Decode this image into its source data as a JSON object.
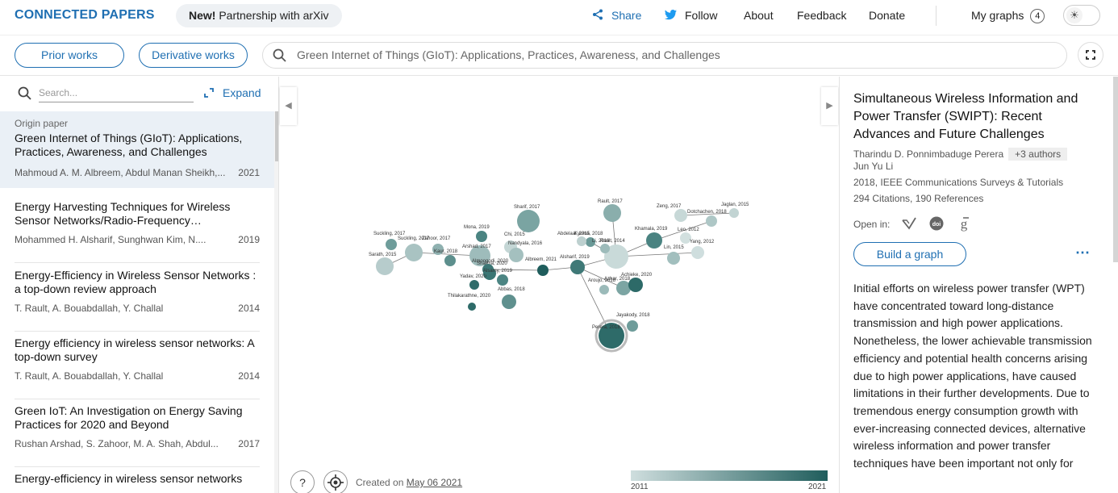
{
  "topbar": {
    "brand": "CONNECTED PAPERS",
    "promo_bold": "New!",
    "promo_text": " Partnership with arXiv",
    "nav": {
      "share": "Share",
      "follow": "Follow",
      "about": "About",
      "feedback": "Feedback",
      "donate": "Donate"
    },
    "my_graphs": "My graphs",
    "my_graphs_count": "4"
  },
  "subbar": {
    "prior_works": "Prior works",
    "derivative_works": "Derivative works",
    "search_value": "Green Internet of Things (GIoT): Applications, Practices, Awareness, and Challenges"
  },
  "left_panel": {
    "search_placeholder": "Search...",
    "expand_label": "Expand",
    "origin": {
      "label": "Origin paper",
      "title": "Green Internet of Things (GIoT): Applications, Practices, Awareness, and Challenges",
      "authors": "Mahmoud A. M. Albreem, Abdul Manan Sheikh,...",
      "year": "2021"
    },
    "items": [
      {
        "title": "Energy Harvesting Techniques for Wireless Sensor Networks/Radio-Frequency…",
        "authors": "Mohammed H. Alsharif, Sunghwan Kim, N....",
        "year": "2019"
      },
      {
        "title": "Energy-Efficiency in Wireless Sensor Networks : a top-down review approach",
        "authors": "T. Rault, A. Bouabdallah, Y. Challal",
        "year": "2014"
      },
      {
        "title": "Energy efficiency in wireless sensor networks: A top-down survey",
        "authors": "T. Rault, A. Bouabdallah, Y. Challal",
        "year": "2014"
      },
      {
        "title": "Green IoT: An Investigation on Energy Saving Practices for 2020 and Beyond",
        "authors": "Rushan Arshad, S. Zahoor, M. A. Shah, Abdul...",
        "year": "2017"
      },
      {
        "title": "Energy-efficiency in wireless sensor networks",
        "authors": "",
        "year": ""
      }
    ]
  },
  "graph": {
    "created_prefix": "Created on ",
    "created_date": "May 06 2021",
    "legend_min": "2011",
    "legend_max": "2021",
    "color_light": "#cfdede",
    "color_dark": "#1f5d5c",
    "nodes": [
      {
        "label": "Sarath, 2015",
        "r": 11,
        "c": "#b7cccc"
      },
      {
        "label": "Suckling, 2017",
        "r": 7,
        "c": "#6f9d9b"
      },
      {
        "label": "Suckling, 2017",
        "r": 11,
        "c": "#a9c3c2"
      },
      {
        "label": "Zahoor, 2017",
        "r": 7,
        "c": "#8fb1b0"
      },
      {
        "label": "Mona, 2019",
        "r": 7,
        "c": "#4b8482"
      },
      {
        "label": "Chi, 2015",
        "r": 8,
        "c": "#c4d6d5"
      },
      {
        "label": "Sharif, 2017",
        "r": 14,
        "c": "#7aa4a2"
      },
      {
        "label": "Arshad, 2017",
        "r": 13,
        "c": "#9ebcbb"
      },
      {
        "label": "Kaur, 2018",
        "r": 7,
        "c": "#5d8f8d"
      },
      {
        "label": "Nandyala, 2016",
        "r": 9,
        "c": "#a4c0bf"
      },
      {
        "label": "Sharma, 2020",
        "r": 8,
        "c": "#3a7674"
      },
      {
        "label": "Yadav, 2020",
        "r": 6,
        "c": "#2f6c6a"
      },
      {
        "label": "Almoogodi, 2020",
        "r": 7,
        "c": "#3c7775"
      },
      {
        "label": "Alsamy, 2019",
        "r": 7,
        "c": "#4c8583"
      },
      {
        "label": "Abbas, 2018",
        "r": 9,
        "c": "#5f908e"
      },
      {
        "label": "Thilakarathne, 2020",
        "r": 5,
        "c": "#2e6b69"
      },
      {
        "label": "Albreem, 2021",
        "r": 7,
        "c": "#1f5d5c"
      },
      {
        "label": "Alsharif, 2019",
        "r": 9,
        "c": "#3f7977"
      },
      {
        "label": "Rault, 2014",
        "r": 15,
        "c": "#c9dad9"
      },
      {
        "label": "Kyuma, 2018",
        "r": 6,
        "c": "#6a9997"
      },
      {
        "label": "Rault, 2017",
        "r": 11,
        "c": "#8aaeac"
      },
      {
        "label": "Abdelaal, 2015",
        "r": 6,
        "c": "#bdd0cf"
      },
      {
        "label": "Khamala, 2019",
        "r": 10,
        "c": "#4a8381"
      },
      {
        "label": "Li, 2016",
        "r": 6,
        "c": "#9dbbba"
      },
      {
        "label": "Zeng, 2017",
        "r": 8,
        "c": "#c7d8d7"
      },
      {
        "label": "Dotchachen, 2018",
        "r": 7,
        "c": "#aec7c6"
      },
      {
        "label": "Jaglan, 2015",
        "r": 6,
        "c": "#c2d4d3"
      },
      {
        "label": "Leo, 2012",
        "r": 7,
        "c": "#d2e0df"
      },
      {
        "label": "Yang, 2012",
        "r": 8,
        "c": "#cfdede"
      },
      {
        "label": "Lin, 2015",
        "r": 8,
        "c": "#a2bfbe"
      },
      {
        "label": "Aroujo, 2018",
        "r": 6,
        "c": "#9bbab9"
      },
      {
        "label": "Azhar, 2018",
        "r": 9,
        "c": "#7ca5a3"
      },
      {
        "label": "Achieke, 2020",
        "r": 9,
        "c": "#2d6a68"
      },
      {
        "label": "Perera, 2018",
        "r": 16,
        "c": "#2e6b69"
      },
      {
        "label": "Jayakody, 2018",
        "r": 7,
        "c": "#6e9c9a"
      }
    ]
  },
  "right_panel": {
    "title": "Simultaneous Wireless Information and Power Transfer (SWIPT): Recent Advances and Future Challenges",
    "authors_line1": "Tharindu D. Ponnimbaduge Perera",
    "more_authors": "+3 authors",
    "authors_line2": "Jun Yu Li",
    "venue": "2018, IEEE Communications Surveys & Tutorials",
    "citations": "294 Citations, 190 References",
    "open_in": "Open in:",
    "build_graph": "Build a graph",
    "more_menu": "⋯",
    "abstract": "Initial efforts on wireless power transfer (WPT) have concentrated toward long-distance transmission and high power applications. Nonetheless, the lower achievable transmission efficiency and potential health concerns arising due to high power applications, have caused limitations in their further developments. Due to tremendous energy consumption growth with ever-increasing connected devices, alternative wireless information and power transfer techniques have been important not only for"
  }
}
